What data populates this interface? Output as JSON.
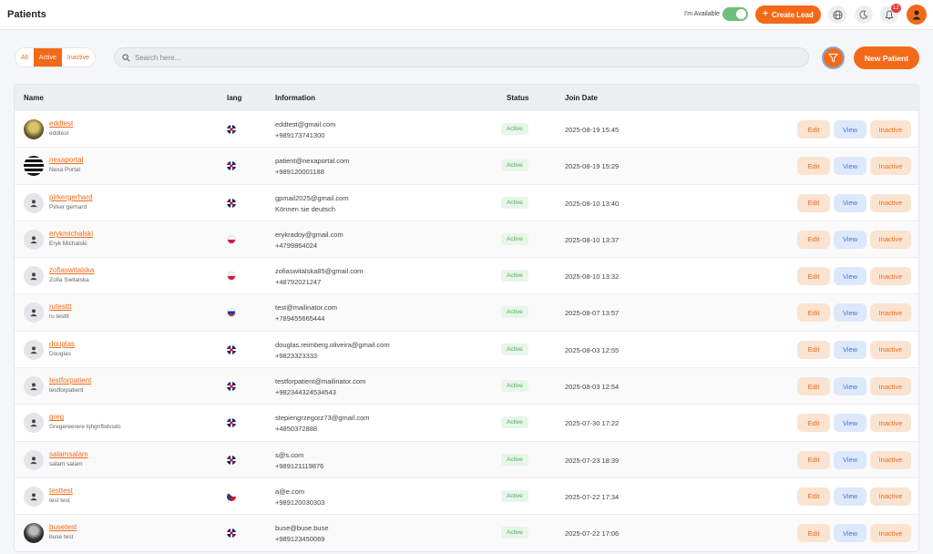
{
  "header": {
    "title": "Patients",
    "availability_label": "I'm Available",
    "create_lead_label": "Create Lead",
    "notification_count": "12"
  },
  "filters": {
    "tabs": [
      {
        "label": "All",
        "active": false
      },
      {
        "label": "Active",
        "active": true
      },
      {
        "label": "Inactive",
        "active": false
      }
    ]
  },
  "search": {
    "placeholder": "Search here...",
    "value": ""
  },
  "toolbar": {
    "new_patient_label": "New Patient"
  },
  "table": {
    "columns": [
      "Name",
      "lang",
      "Information",
      "Status",
      "Join Date"
    ],
    "actions": {
      "edit": "Edit",
      "view": "View",
      "inactive": "Inactive"
    },
    "rows": [
      {
        "username": "eddtest",
        "fullname": "eddtest",
        "lang": "gb",
        "email": "eddtest@gmail.com",
        "phone": "+989173741300",
        "status": "Active",
        "joined": "2025-08-19 15:45",
        "avatar": "photo1"
      },
      {
        "username": "nexaportal",
        "fullname": "Nexa Portal",
        "lang": "gb",
        "email": "patient@nexaportal.com",
        "phone": "+989120001188",
        "status": "Active",
        "joined": "2025-08-19 15:29",
        "avatar": "photo2"
      },
      {
        "username": "pirkergerhard",
        "fullname": "Pirker gerhard",
        "lang": "gb",
        "email": "gpmail2025@gmail.com",
        "phone": "Können sie deutsch",
        "status": "Active",
        "joined": "2025-08-10 13:40",
        "avatar": "default"
      },
      {
        "username": "erykmichalski",
        "fullname": "Eryk Michalski",
        "lang": "pl",
        "email": "erykradoy@gmail.com",
        "phone": "+4799864024",
        "status": "Active",
        "joined": "2025-08-10 13:37",
        "avatar": "default"
      },
      {
        "username": "zofiaswitalska",
        "fullname": "Zofia Switalska",
        "lang": "pl",
        "email": "zofiaswitalska85@gmail.com",
        "phone": "+48792021247",
        "status": "Active",
        "joined": "2025-08-10 13:32",
        "avatar": "default"
      },
      {
        "username": "rutesttt",
        "fullname": "ru testtt",
        "lang": "ru",
        "email": "test@mailinator.com",
        "phone": "+789455665444",
        "status": "Active",
        "joined": "2025-08-07 13:57",
        "avatar": "default"
      },
      {
        "username": "douglas",
        "fullname": "Douglas",
        "lang": "gb",
        "email": "douglas.reimberg.oliveira@gmail.com",
        "phone": "+9823323333",
        "status": "Active",
        "joined": "2025-08-03 12:55",
        "avatar": "default"
      },
      {
        "username": "testforpatient",
        "fullname": "testforpatient",
        "lang": "gb",
        "email": "testforpatient@mailinator.com",
        "phone": "+982344324534543",
        "status": "Active",
        "joined": "2025-08-03 12:54",
        "avatar": "default"
      },
      {
        "username": "greg",
        "fullname": "Gregereerere kjhgnfbdvsdc",
        "lang": "gb",
        "email": "stepiengrzegorz73@gmail.com",
        "phone": "+4850372888",
        "status": "Active",
        "joined": "2025-07-30 17:22",
        "avatar": "default"
      },
      {
        "username": "salamsalam",
        "fullname": "salam salam",
        "lang": "gb",
        "email": "s@s.com",
        "phone": "+989121119876",
        "status": "Active",
        "joined": "2025-07-23 18:39",
        "avatar": "default"
      },
      {
        "username": "testtest",
        "fullname": "test test",
        "lang": "cz",
        "email": "a@e.com",
        "phone": "+989120030303",
        "status": "Active",
        "joined": "2025-07-22 17:34",
        "avatar": "default"
      },
      {
        "username": "busetest",
        "fullname": "buse test",
        "lang": "gb",
        "email": "buse@buse.buse",
        "phone": "+989123450069",
        "status": "Active",
        "joined": "2025-07-22 17:06",
        "avatar": "photo3"
      }
    ]
  }
}
